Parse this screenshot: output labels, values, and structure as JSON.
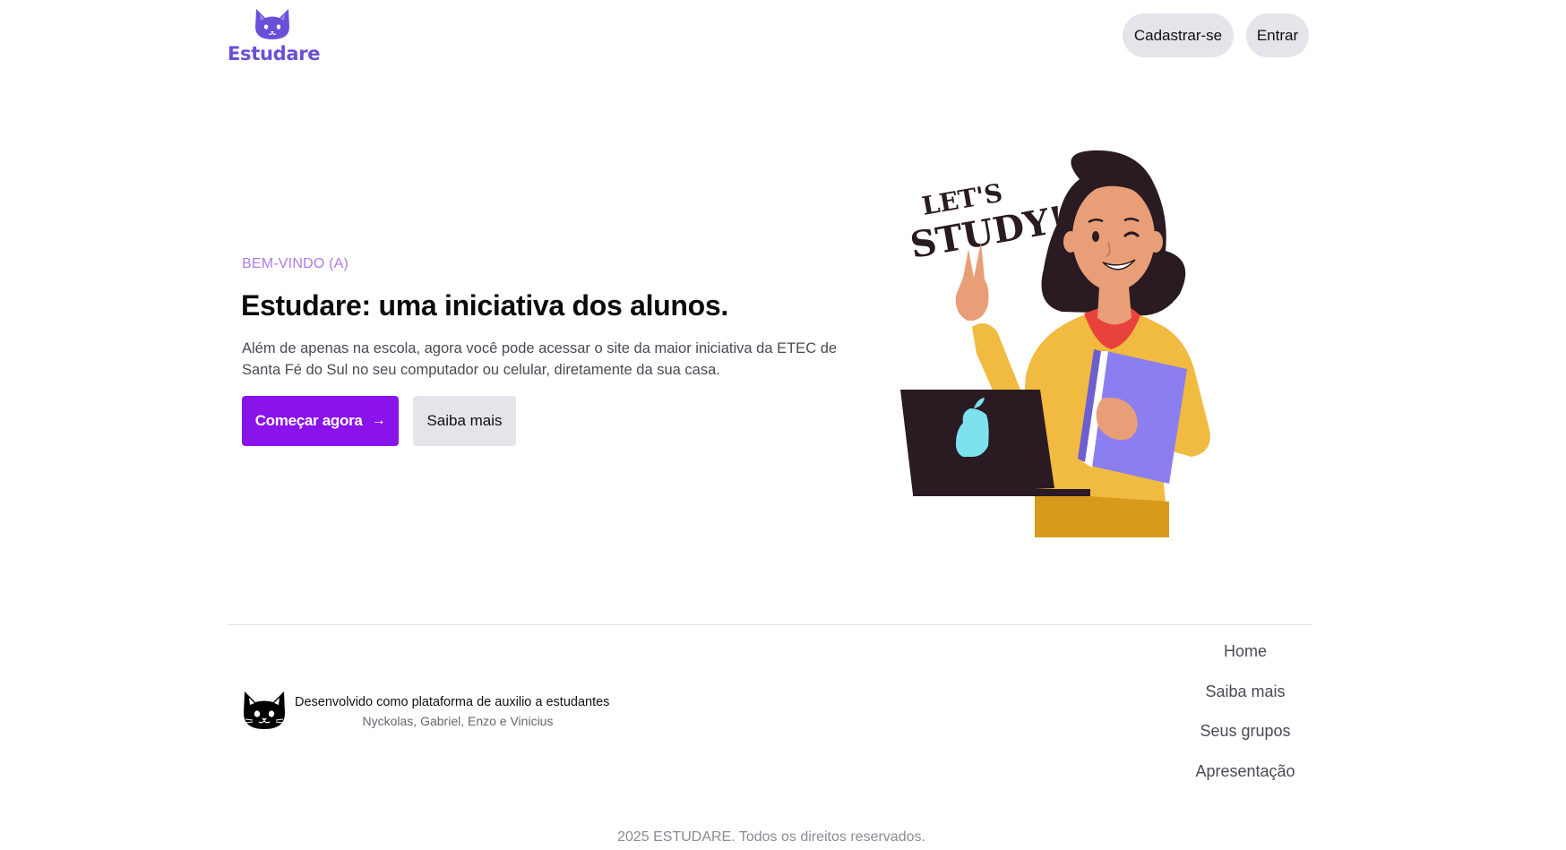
{
  "header": {
    "logo_text": "Estudare",
    "signup_label": "Cadastrar-se",
    "login_label": "Entrar"
  },
  "hero": {
    "eyebrow": "BEM-VINDO (A)",
    "title": "Estudare: uma iniciativa dos alunos.",
    "description": "Além de apenas na escola, agora você pode acessar o site da maior iniciativa da ETEC de Santa Fé do Sul no seu computador ou celular, diretamente da sua casa.",
    "start_label": "Começar agora",
    "start_icon": "arrow-right-icon",
    "more_label": "Saiba mais",
    "illustration_text_line1": "LET'S",
    "illustration_text_line2": "STUDY!"
  },
  "footer": {
    "tagline": "Desenvolvido como plataforma de auxilio a estudantes",
    "authors": "Nyckolas, Gabriel, Enzo e Vinicius",
    "nav": [
      "Home",
      "Saiba mais",
      "Seus grupos",
      "Apresentação"
    ],
    "copyright": "2025 ESTUDARE. Todos os direitos reservados."
  },
  "colors": {
    "brand": "#6b4fd8",
    "primary_button": "#8a12ea",
    "eyebrow": "#b27ae6",
    "secondary_button": "#e4e4ea"
  }
}
